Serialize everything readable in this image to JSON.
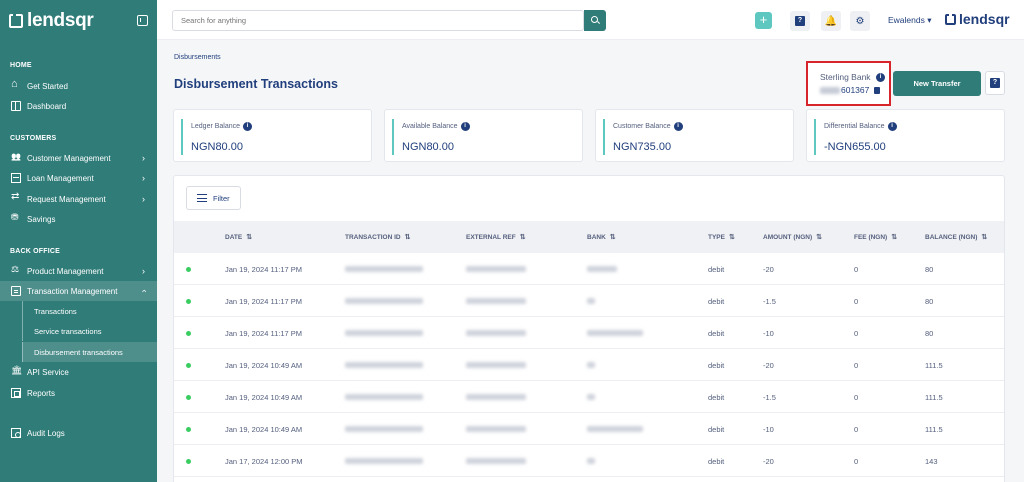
{
  "brand": {
    "name": "lendsqr"
  },
  "sidebar": {
    "sections": [
      {
        "title": "HOME"
      },
      {
        "title": "CUSTOMERS"
      },
      {
        "title": "BACK OFFICE"
      }
    ],
    "items": {
      "get_started": "Get Started",
      "dashboard": "Dashboard",
      "customer_management": "Customer Management",
      "loan_management": "Loan Management",
      "request_management": "Request Management",
      "savings": "Savings",
      "product_management": "Product Management",
      "transaction_management": "Transaction Management",
      "transactions": "Transactions",
      "service_transactions": "Service transactions",
      "disbursement_transactions": "Disbursement transactions",
      "api_service": "API Service",
      "reports": "Reports",
      "audit_logs": "Audit Logs"
    }
  },
  "topbar": {
    "search_placeholder": "Search for anything",
    "plus_label": "+",
    "user_name": "Ewalends",
    "user_caret": "▾"
  },
  "page": {
    "breadcrumb": "Disbursements",
    "title": "Disbursement Transactions",
    "bank_name": "Sterling Bank",
    "account_suffix": "601367",
    "new_transfer": "New Transfer"
  },
  "balances": [
    {
      "label": "Ledger Balance",
      "value": "NGN80.00"
    },
    {
      "label": "Available Balance",
      "value": "NGN80.00"
    },
    {
      "label": "Customer Balance",
      "value": "NGN735.00"
    },
    {
      "label": "Differential Balance",
      "value": "-NGN655.00"
    }
  ],
  "table": {
    "filter_label": "Filter",
    "columns": [
      "DATE",
      "TRANSACTION ID",
      "EXTERNAL REF",
      "BANK",
      "TYPE",
      "AMOUNT (NGN)",
      "FEE (NGN)",
      "BALANCE (NGN)"
    ],
    "rows": [
      {
        "date": "Jan 19, 2024 11:17 PM",
        "type": "debit",
        "amount": "-20",
        "fee": "0",
        "balance": "80",
        "bank_blur": "short"
      },
      {
        "date": "Jan 19, 2024 11:17 PM",
        "type": "debit",
        "amount": "-1.5",
        "fee": "0",
        "balance": "80",
        "bank_blur": "tiny"
      },
      {
        "date": "Jan 19, 2024 11:17 PM",
        "type": "debit",
        "amount": "-10",
        "fee": "0",
        "balance": "80",
        "bank_blur": "long"
      },
      {
        "date": "Jan 19, 2024 10:49 AM",
        "type": "debit",
        "amount": "-20",
        "fee": "0",
        "balance": "111.5",
        "bank_blur": "tiny"
      },
      {
        "date": "Jan 19, 2024 10:49 AM",
        "type": "debit",
        "amount": "-1.5",
        "fee": "0",
        "balance": "111.5",
        "bank_blur": "tiny"
      },
      {
        "date": "Jan 19, 2024 10:49 AM",
        "type": "debit",
        "amount": "-10",
        "fee": "0",
        "balance": "111.5",
        "bank_blur": "long"
      },
      {
        "date": "Jan 17, 2024 12:00 PM",
        "type": "debit",
        "amount": "-20",
        "fee": "0",
        "balance": "143",
        "bank_blur": "tiny"
      }
    ]
  },
  "colors": {
    "sidebar": "#2f7c78",
    "accent": "#5ec8c0",
    "text": "#213f7d",
    "highlight": "#d8252b",
    "status_success": "#39cd62"
  }
}
